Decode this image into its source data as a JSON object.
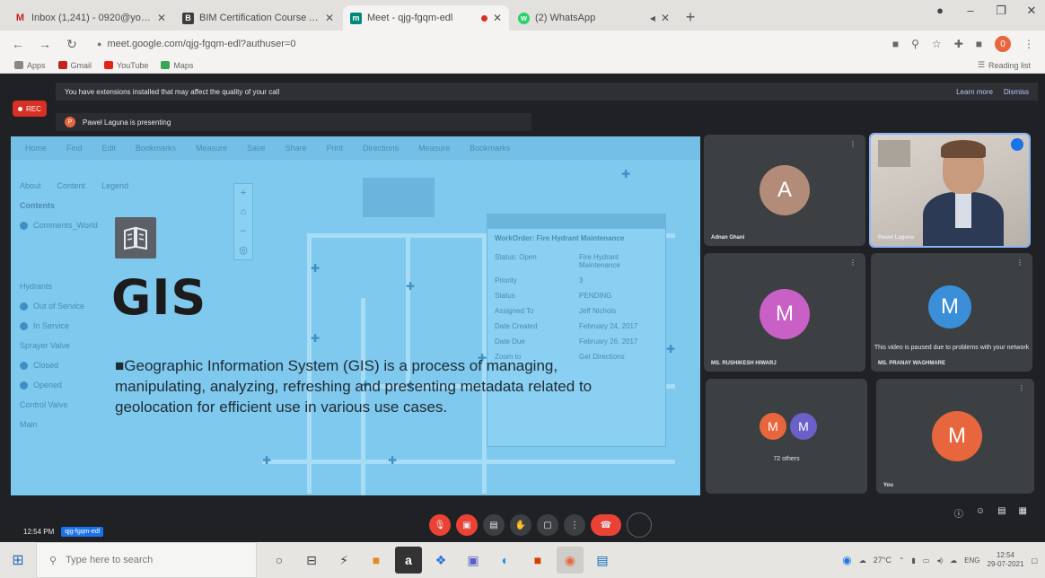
{
  "browser": {
    "tabs": [
      {
        "title": "Inbox (1,241) - 0920@yoursin",
        "icon_color": "#c5221f",
        "icon_letter": "M",
        "active": false
      },
      {
        "title": "BIM Certification Course Alt",
        "icon_color": "#3c3c3c",
        "icon_letter": "B",
        "active": false
      },
      {
        "title": "Meet - qjg-fgqm-edl",
        "icon_color": "#00897b",
        "icon_letter": "m",
        "active": true,
        "recording": true
      },
      {
        "title": "(2) WhatsApp",
        "icon_color": "#25d366",
        "icon_letter": "w",
        "active": false
      }
    ],
    "new_tab": "+",
    "url": "meet.google.com/qjg-fgqm-edl?authuser=0",
    "profile_letter": "0"
  },
  "bookmarks": {
    "items": [
      {
        "label": "Apps",
        "color": "#777777"
      },
      {
        "label": "Gmail",
        "color": "#c5221f"
      },
      {
        "label": "YouTube",
        "color": "#e62117"
      },
      {
        "label": "Maps",
        "color": "#34a853"
      }
    ],
    "reading_list": "Reading list"
  },
  "meet": {
    "extension_banner": "You have extensions installed that may affect the quality of your call",
    "banner_learn_more": "Learn more",
    "banner_dismiss": "Dismiss",
    "rec_label": "REC",
    "presenting_text": "Pawel Laguna is presenting",
    "slide": {
      "title": "GIS",
      "body": "■Geographic Information System (GIS) is a process of managing, manipulating, analyzing, refreshing and presenting metadata related to geolocation for efficient use in various use cases.",
      "toolbar": [
        "Home",
        "Find",
        "Edit",
        "Bookmarks",
        "Measure",
        "Save",
        "Share",
        "Print",
        "Directions",
        "Measure",
        "Bookmarks"
      ],
      "panel_tabs": [
        "About",
        "Content",
        "Legend"
      ],
      "panel_items": [
        "Contents",
        "Comments_World",
        "Hydrants",
        "Out of Service",
        "In Service",
        "Sprayer Valve",
        "Closed",
        "Opened",
        "Control Valve",
        "Main"
      ],
      "popup_title": "WorkOrder: Fire Hydrant Maintenance",
      "popup_fields": [
        "Status: Open",
        "Fire Hydrant Maintenance",
        "Priority",
        "3",
        "Status",
        "PENDING",
        "Assigned To",
        "Jeff Nichols",
        "Date Created",
        "February 24, 2017",
        "Date Due",
        "February 26, 2017"
      ],
      "popup_footer": [
        "Zoom to",
        "Get Directions"
      ]
    },
    "participants": [
      {
        "name": "Adnan Ghani",
        "letter": "A",
        "color": "#b38b79"
      },
      {
        "name": "Pawel Laguna",
        "video": true
      },
      {
        "name": "MS. RUSHIKESH HIWARJ",
        "letter": "M",
        "color": "#c860c6"
      },
      {
        "name": "MS. PRANAY WAGHMARE",
        "letter": "M",
        "color": "#3b8fd9",
        "message": "This video is paused due to problems with your network"
      },
      {
        "name": "",
        "others": "72 others",
        "letters": [
          "M",
          "M"
        ],
        "colors": [
          "#e8663d",
          "#6b5fc9"
        ]
      },
      {
        "name": "You",
        "letter": "M",
        "color": "#e8663d"
      }
    ],
    "time": "12:54 PM",
    "meeting_code": "qjg-fgqm-edl",
    "controls": [
      "mic-off",
      "camera-off",
      "captions",
      "raise-hand",
      "present",
      "more",
      "hang-up",
      "ring"
    ]
  },
  "taskbar": {
    "search_placeholder": "Type here to search",
    "apps": [
      "task-view",
      "file-explorer",
      "app-bolt",
      "store",
      "amazon",
      "dropbox",
      "teams",
      "edge",
      "office",
      "chrome",
      "outlook"
    ],
    "amazon_letter": "a",
    "temperature": "27°C",
    "lang": "ENG",
    "clock_time": "12:54",
    "clock_date": "29-07-2021"
  }
}
